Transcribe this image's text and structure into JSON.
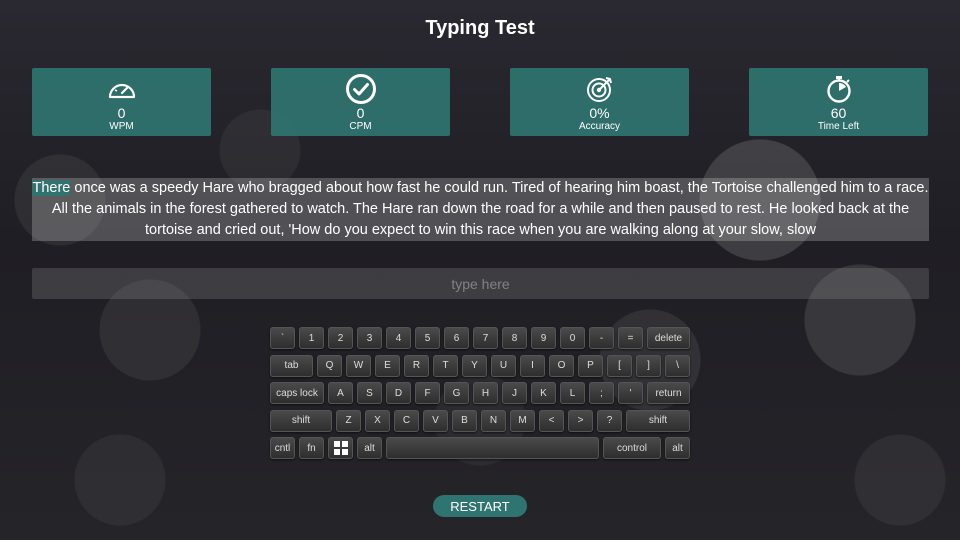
{
  "title": "Typing Test",
  "stats": [
    {
      "icon": "speedometer-icon",
      "value": "0",
      "label": "WPM"
    },
    {
      "icon": "check-circle-icon",
      "value": "0",
      "label": "CPM"
    },
    {
      "icon": "target-icon",
      "value": "0%",
      "label": "Accuracy"
    },
    {
      "icon": "stopwatch-icon",
      "value": "60",
      "label": "Time Left"
    }
  ],
  "passage": {
    "current_word": "There",
    "rest": " once was a speedy Hare who bragged about how fast he could run. Tired of hearing him boast, the Tortoise challenged him to a race. All the animals in the forest gathered to watch. The Hare ran down the road for a while and then paused to rest. He looked back at the tortoise and cried out, 'How do you expect to win this race when you are walking along at your slow, slow"
  },
  "input": {
    "placeholder": "type here",
    "value": ""
  },
  "keyboard": {
    "row1": [
      "`",
      "1",
      "2",
      "3",
      "4",
      "5",
      "6",
      "7",
      "8",
      "9",
      "0",
      "-",
      "=",
      "delete"
    ],
    "row2": [
      "tab",
      "Q",
      "W",
      "E",
      "R",
      "T",
      "Y",
      "U",
      "I",
      "O",
      "P",
      "[",
      "]",
      "\\"
    ],
    "row3": [
      "caps lock",
      "A",
      "S",
      "D",
      "F",
      "G",
      "H",
      "J",
      "K",
      "L",
      ";",
      "'",
      "return"
    ],
    "row4": [
      "shift",
      "Z",
      "X",
      "C",
      "V",
      "B",
      "N",
      "M",
      "<",
      ">",
      "?",
      "shift"
    ],
    "row5": [
      "cntl",
      "fn",
      "",
      "alt",
      "",
      "control",
      "alt"
    ]
  },
  "restart_label": "RESTART",
  "colors": {
    "accent": "#2f7470"
  }
}
